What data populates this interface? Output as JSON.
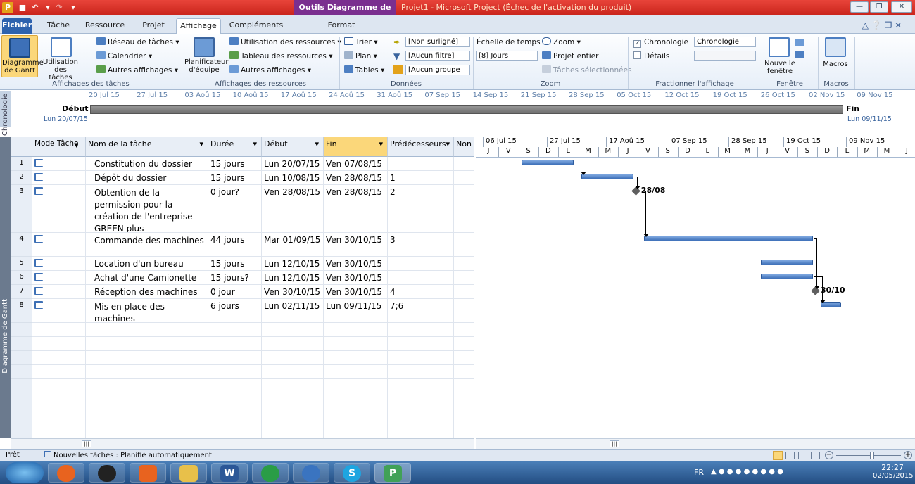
{
  "window": {
    "context_tab": "Outils Diagramme de Gantt",
    "title": "Projet1 - Microsoft Project (Échec de l'activation du produit)",
    "colors": {
      "title_bar": "#d2322a",
      "context": "#7a2f8f",
      "bar": "#4a7cc0"
    }
  },
  "tabs": [
    "Fichier",
    "Tâche",
    "Ressource",
    "Projet",
    "Affichage",
    "Compléments",
    "Format"
  ],
  "ribbon": {
    "taches": {
      "gantt": "Diagramme de Gantt",
      "usage": "Utilisation des tâches",
      "reseau": "Réseau de tâches",
      "calendrier": "Calendrier",
      "autres": "Autres affichages",
      "label": "Affichages des tâches"
    },
    "ressources": {
      "planificateur": "Planificateur d'équipe",
      "utilisation": "Utilisation des ressources",
      "tableau": "Tableau des ressources",
      "autres": "Autres affichages",
      "label": "Affichages des ressources"
    },
    "donnees": {
      "trier": "Trier",
      "plan": "Plan",
      "tables": "Tables",
      "surligne": "[Non surligné]",
      "filtre": "[Aucun filtre]",
      "groupe": "[Aucun groupe",
      "label": "Données"
    },
    "zoom": {
      "echelle": "Échelle de temps :",
      "echelle_val": "[8] Jours",
      "zoom": "Zoom",
      "projet": "Projet entier",
      "taches_sel": "Tâches sélectionnées",
      "label": "Zoom"
    },
    "fractionner": {
      "chronologie": "Chronologie",
      "chronologie_val": "Chronologie",
      "details": "Détails",
      "label": "Fractionner l'affichage"
    },
    "fenetre": {
      "nouvelle": "Nouvelle fenêtre",
      "label": "Fenêtre"
    },
    "macros": {
      "macros": "Macros",
      "label": "Macros"
    }
  },
  "timeline": {
    "side_label": "Chronologie",
    "start_label": "Début",
    "start_date": "Lun 20/07/15",
    "end_label": "Fin",
    "end_date": "Lun 09/11/15",
    "ticks": [
      "20 Jul 15",
      "27 Jul 15",
      "03 Aoû 15",
      "10 Aoû 15",
      "17 Aoû 15",
      "24 Aoû 15",
      "31 Aoû 15",
      "07 Sep 15",
      "14 Sep 15",
      "21 Sep 15",
      "28 Sep 15",
      "05 Oct 15",
      "12 Oct 15",
      "19 Oct 15",
      "26 Oct 15",
      "02 Nov 15",
      "09 Nov 15"
    ]
  },
  "view_label": "Diagramme de Gantt",
  "table": {
    "headers": [
      "Mode Tâche",
      "Nom de la tâche",
      "Durée",
      "Début",
      "Fin",
      "Prédécesseurs",
      "Non"
    ],
    "rows": [
      {
        "id": "1",
        "name": "Constitution du dossier",
        "duration": "15 jours",
        "start": "Lun 20/07/15",
        "end": "Ven 07/08/15",
        "pred": ""
      },
      {
        "id": "2",
        "name": "Dépôt du dossier",
        "duration": "15 jours",
        "start": "Lun 10/08/15",
        "end": "Ven 28/08/15",
        "pred": "1"
      },
      {
        "id": "3",
        "name": "Obtention de la permission pour la création de l'entreprise GREEN plus",
        "duration": "0 jour?",
        "start": "Ven 28/08/15",
        "end": "Ven 28/08/15",
        "pred": "2"
      },
      {
        "id": "4",
        "name": "Commande des machines",
        "duration": "44 jours",
        "start": "Mar 01/09/15",
        "end": "Ven 30/10/15",
        "pred": "3"
      },
      {
        "id": "5",
        "name": "Location d'un bureau",
        "duration": "15 jours",
        "start": "Lun 12/10/15",
        "end": "Ven 30/10/15",
        "pred": ""
      },
      {
        "id": "6",
        "name": " Achat d'une Camionette",
        "duration": "15 jours?",
        "start": "Lun 12/10/15",
        "end": "Ven 30/10/15",
        "pred": ""
      },
      {
        "id": "7",
        "name": "Réception des machines",
        "duration": "0 jour",
        "start": "Ven 30/10/15",
        "end": "Ven 30/10/15",
        "pred": "4"
      },
      {
        "id": "8",
        "name": "Mis en place des machines",
        "duration": "6 jours",
        "start": "Lun 02/11/15",
        "end": "Lun 09/11/15",
        "pred": "7;6"
      }
    ]
  },
  "gantt": {
    "months": [
      "06 Jul 15",
      "27 Jul 15",
      "17 Aoû 15",
      "07 Sep 15",
      "28 Sep 15",
      "19 Oct 15",
      "09 Nov 15"
    ],
    "days": [
      "J",
      "V",
      "S",
      "D",
      "L",
      "M",
      "M",
      "J",
      "V",
      "S",
      "D",
      "L",
      "M",
      "M",
      "J",
      "V",
      "S",
      "D",
      "L",
      "M",
      "M",
      "J"
    ],
    "milestone_3": "28/08",
    "milestone_7": "30/10"
  },
  "status": {
    "ready": "Prêt",
    "new_tasks": "Nouvelles tâches : Planifié automatiquement"
  },
  "taskbar": {
    "lang": "FR",
    "time": "22:27",
    "date": "02/05/2015"
  }
}
